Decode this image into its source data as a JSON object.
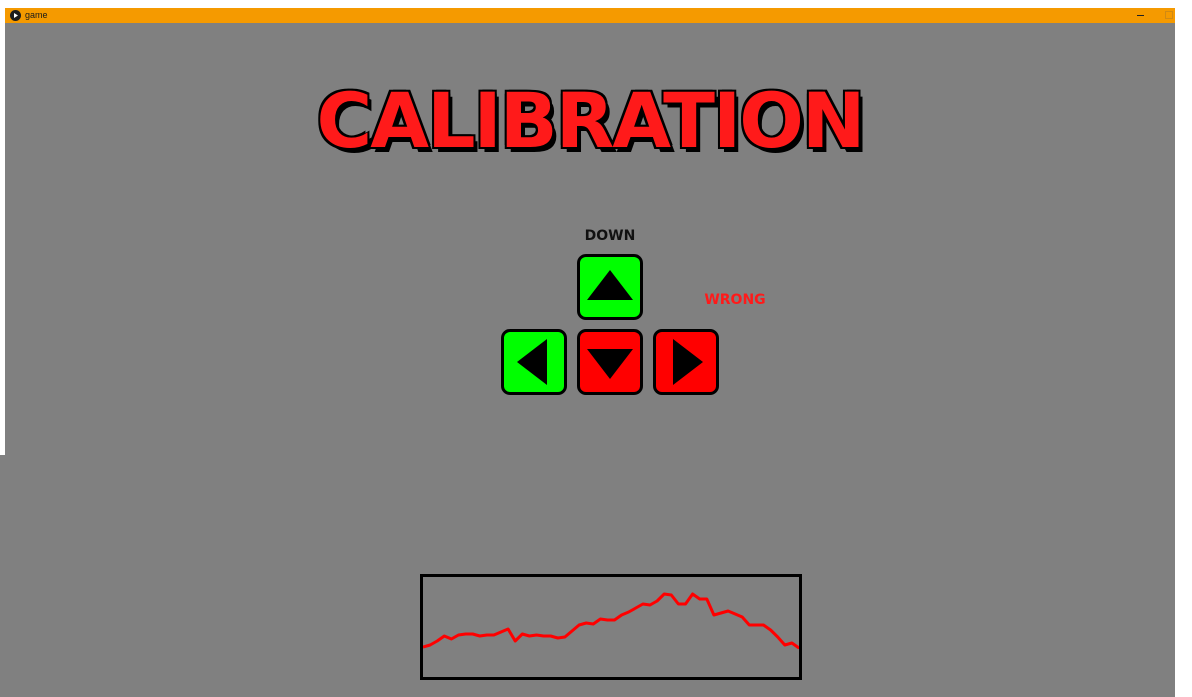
{
  "window": {
    "title": "game",
    "titlebar_color": "#f59a00",
    "background_color": "#808080"
  },
  "game": {
    "title": "CALIBRATION",
    "title_color": "#ff1a1a",
    "prompt": "DOWN",
    "feedback": "WRONG",
    "feedback_color": "#ff1a1a"
  },
  "keys": [
    {
      "id": "up",
      "icon": "arrow-up-icon",
      "color": "#00ff00"
    },
    {
      "id": "left",
      "icon": "arrow-left-icon",
      "color": "#00ff00"
    },
    {
      "id": "down",
      "icon": "arrow-down-icon",
      "color": "#ff0000"
    },
    {
      "id": "right",
      "icon": "arrow-right-icon",
      "color": "#ff0000"
    }
  ],
  "chart_data": {
    "type": "line",
    "title": "",
    "xlabel": "",
    "ylabel": "",
    "grid": false,
    "legend": "none",
    "line_color": "#ff0000",
    "ylim": [
      0,
      100
    ],
    "x": [
      0,
      1,
      2,
      3,
      4,
      5,
      6,
      7,
      8,
      9,
      10,
      11,
      12,
      13,
      14,
      15,
      16,
      17,
      18,
      19,
      20,
      21,
      22,
      23,
      24,
      25,
      26,
      27,
      28,
      29,
      30,
      31,
      32,
      33,
      34,
      35,
      36,
      37,
      38,
      39,
      40,
      41,
      42,
      43,
      44,
      45,
      46,
      47,
      48,
      49,
      50,
      51,
      52,
      53
    ],
    "series": [
      {
        "values": [
          30,
          32,
          36,
          41,
          38,
          42,
          43,
          43,
          41,
          42,
          42,
          45,
          48,
          36,
          43,
          41,
          42,
          41,
          41,
          39,
          40,
          46,
          52,
          54,
          53,
          58,
          57,
          57,
          62,
          65,
          69,
          73,
          72,
          76,
          83,
          82,
          73,
          73,
          83,
          78,
          78,
          62,
          64,
          66,
          63,
          60,
          52,
          52,
          52,
          47,
          40,
          32,
          34,
          29,
          28
        ]
      }
    ]
  }
}
